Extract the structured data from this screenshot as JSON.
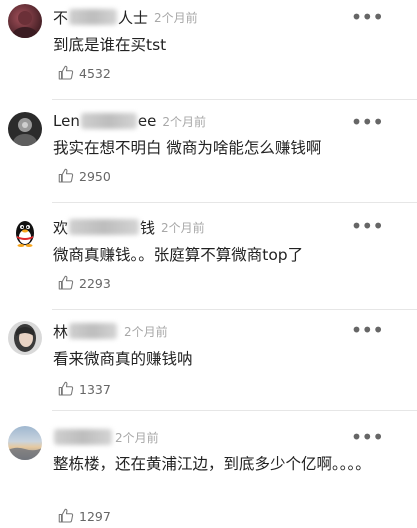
{
  "more_glyph": "•••",
  "comments": [
    {
      "name_prefix": "不",
      "name_suffix": "人士",
      "time": "2个月前",
      "text": "到底是谁在买tst",
      "likes": "4532",
      "avatar_icon": "photo-avatar-icon"
    },
    {
      "name_prefix": "Len",
      "name_suffix": "ee",
      "time": "2个月前",
      "text": "我实在想不明白 微商为啥能怎么赚钱啊",
      "likes": "2950",
      "avatar_icon": "photo-avatar-icon"
    },
    {
      "name_prefix": "欢",
      "name_suffix": "钱",
      "time": "2个月前",
      "text": "微商真赚钱。。张庭算不算微商top了",
      "likes": "2293",
      "avatar_icon": "penguin-avatar-icon"
    },
    {
      "name_prefix": "林",
      "name_suffix": "",
      "time": "2个月前",
      "text": "看来微商真的赚钱呐",
      "likes": "1337",
      "avatar_icon": "photo-avatar-icon"
    },
    {
      "name_prefix": "",
      "name_suffix": "",
      "time": "2个月前",
      "text": "整栋楼，还在黄浦江边，到底多少个亿啊。。。。",
      "likes": "1297",
      "avatar_icon": "landscape-avatar-icon"
    }
  ]
}
